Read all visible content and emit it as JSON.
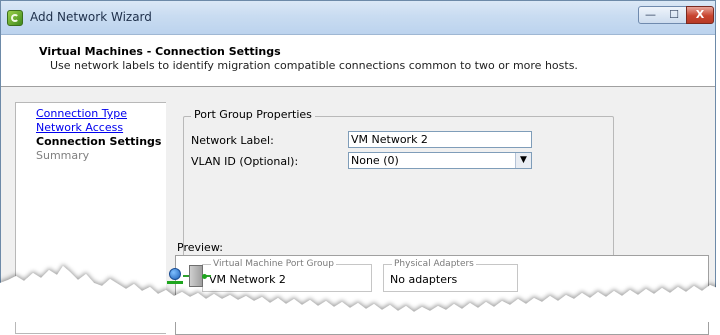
{
  "window": {
    "title": "Add Network Wizard",
    "controls": {
      "minimize": "—",
      "maximize": "☐",
      "close": "X"
    }
  },
  "header": {
    "title": "Virtual Machines - Connection Settings",
    "subtitle": "Use network labels to identify migration compatible connections common to two or more hosts."
  },
  "nav": {
    "items": [
      {
        "label": "Connection Type",
        "state": "link"
      },
      {
        "label": "Network Access",
        "state": "link"
      },
      {
        "label": "Connection Settings",
        "state": "current"
      },
      {
        "label": "Summary",
        "state": "pending"
      }
    ]
  },
  "port_group": {
    "legend": "Port Group Properties",
    "network_label_label": "Network Label:",
    "network_label_value": "VM Network 2",
    "vlan_label": "VLAN ID (Optional):",
    "vlan_value": "None (0)"
  },
  "preview": {
    "label": "Preview:",
    "vm_group_legend": "Virtual Machine Port Group",
    "vm_group_value": "VM Network 2",
    "adapters_legend": "Physical Adapters",
    "adapters_value": "No adapters"
  },
  "icons": {
    "app": "wizard-network-icon",
    "vm": "vm-network-icon",
    "switch": "virtual-switch-icon"
  },
  "colors": {
    "link": "#0000ee",
    "connector": "#2ea02e",
    "titlebar": "#c9dcf1"
  }
}
